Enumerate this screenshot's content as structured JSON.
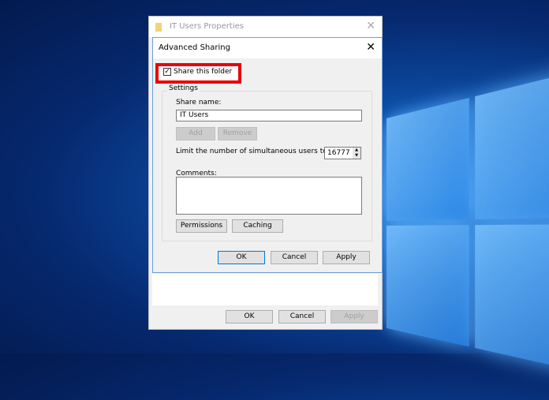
{
  "properties_window": {
    "title": "IT Users Properties",
    "ok": "OK",
    "cancel": "Cancel",
    "apply": "Apply"
  },
  "advanced_sharing": {
    "title": "Advanced Sharing",
    "share_checkbox_label": "Share this folder",
    "share_checked": true,
    "settings_group": "Settings",
    "share_name_label": "Share name:",
    "share_name_value": "IT Users",
    "add": "Add",
    "remove": "Remove",
    "limit_label": "Limit the number of simultaneous users to:",
    "limit_value": "16777",
    "comments_label": "Comments:",
    "comments_value": "",
    "permissions": "Permissions",
    "caching": "Caching",
    "ok": "OK",
    "cancel": "Cancel",
    "apply": "Apply"
  },
  "colors": {
    "highlight": "#e8000b",
    "accent": "#0078d7"
  }
}
